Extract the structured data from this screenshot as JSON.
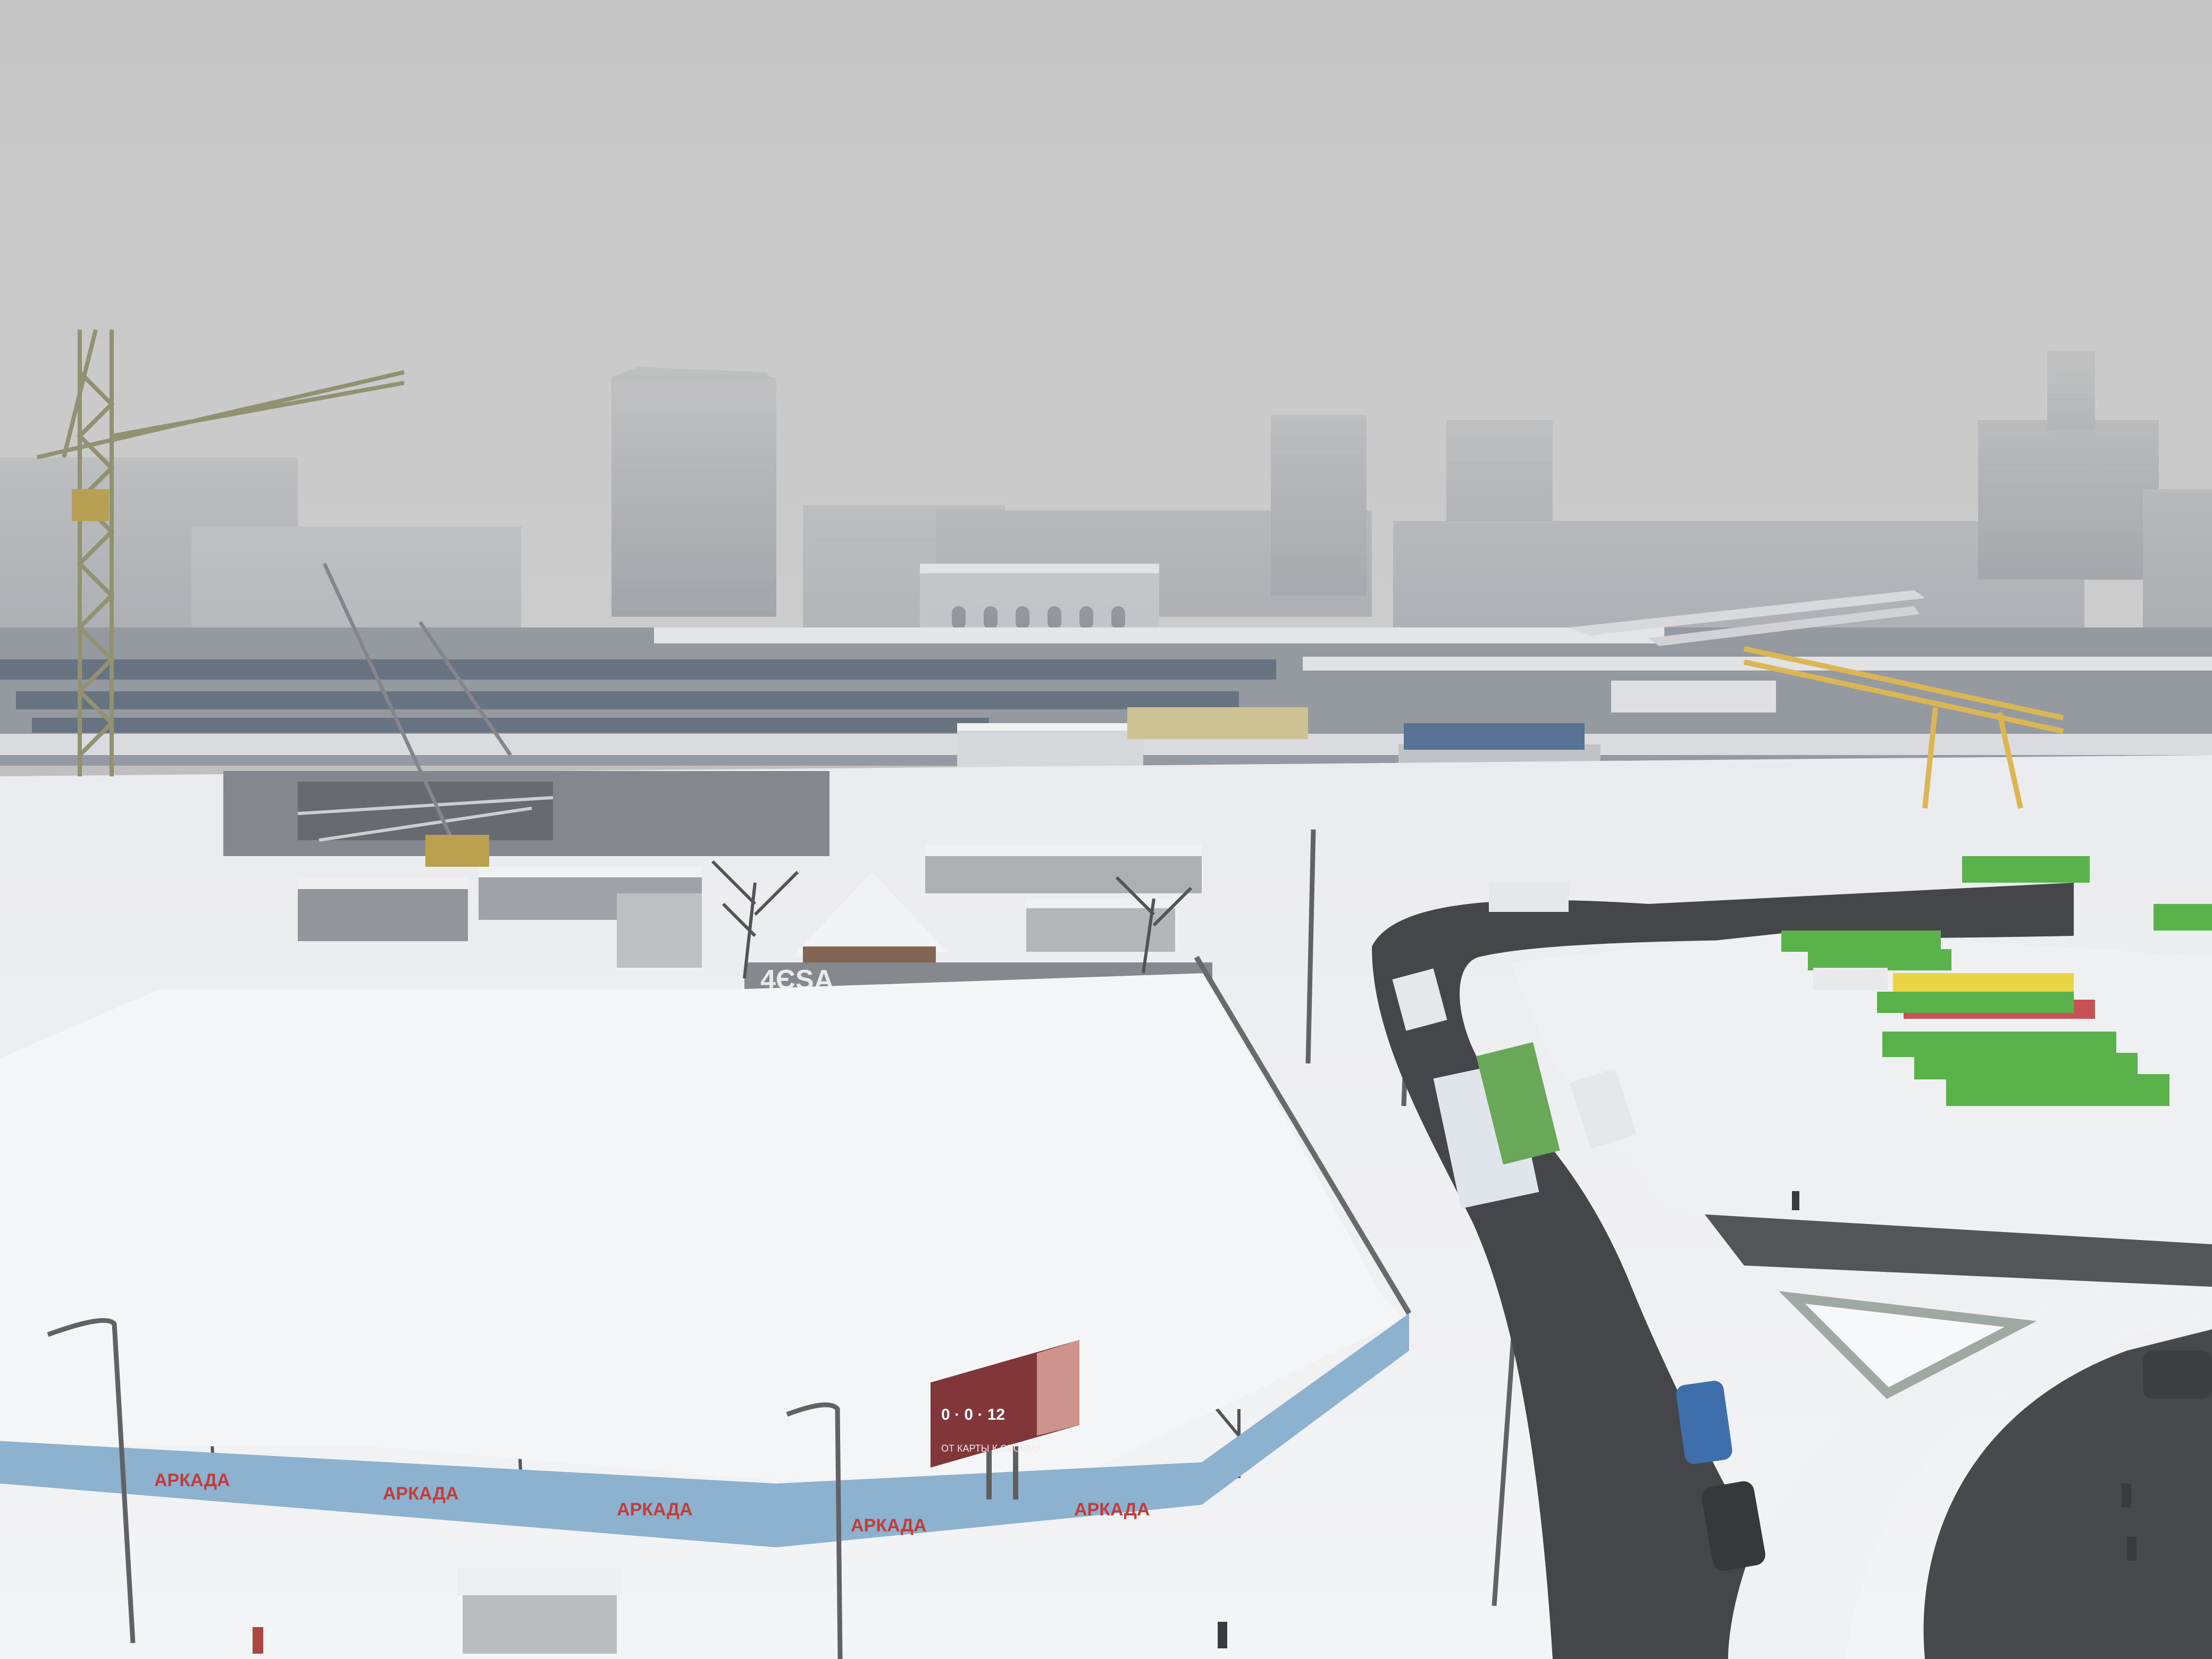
{
  "scene": {
    "description_kind": "photo",
    "colors": {
      "sky": "#c9c9c9",
      "haze": "#bdbdbd",
      "building": "#9ea2a6",
      "snow": "#f1f2f4",
      "road": "#3a3b3e",
      "bus_green": "#4fae3f",
      "bus_yellow": "#e8d23a",
      "crane_yellow": "#d9b24a",
      "fence_blue": "#7aa7c9"
    }
  },
  "fence_banners": [
    "АРКАДА",
    "АРКАДА",
    "АРКАДА",
    "АРКАДА",
    "АРКАДА"
  ],
  "graffiti": "4ЄЅА",
  "billboard": {
    "timer": "0 · 0 · 12",
    "caption": "ОТ КАРТЫ К СВОЕМУ"
  }
}
